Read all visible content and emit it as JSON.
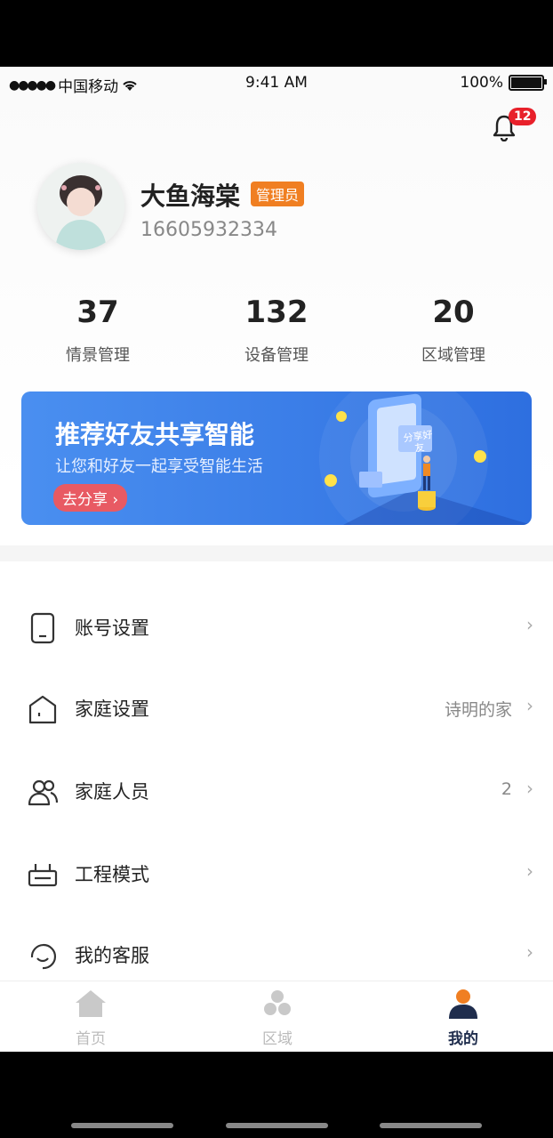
{
  "status_bar": {
    "carrier": "中国移动",
    "time": "9:41 AM",
    "battery": "100%"
  },
  "notifications": {
    "count": "12"
  },
  "profile": {
    "name": "大鱼海棠",
    "role": "管理员",
    "phone": "16605932334"
  },
  "stats": [
    {
      "value": "37",
      "label": "情景管理"
    },
    {
      "value": "132",
      "label": "设备管理"
    },
    {
      "value": "20",
      "label": "区域管理"
    }
  ],
  "banner": {
    "title": "推荐好友共享智能",
    "subtitle": "让您和好友一起享受智能生活",
    "button": "去分享",
    "art_text": "分享好友"
  },
  "menu": [
    {
      "label": "账号设置",
      "value": "",
      "icon": "phone-icon"
    },
    {
      "label": "家庭设置",
      "value": "诗明的家",
      "icon": "home-outline-icon"
    },
    {
      "label": "家庭人员",
      "value": "2",
      "icon": "people-icon"
    },
    {
      "label": "工程模式",
      "value": "",
      "icon": "router-icon"
    },
    {
      "label": "我的客服",
      "value": "",
      "icon": "support-icon"
    }
  ],
  "tabs": [
    {
      "label": "首页",
      "icon": "home-icon",
      "active": false
    },
    {
      "label": "区域",
      "icon": "area-icon",
      "active": false
    },
    {
      "label": "我的",
      "icon": "user-icon",
      "active": true
    }
  ],
  "colors": {
    "accent_orange": "#f07f22",
    "badge_red": "#e8202a",
    "banner_blue": "#3a7de8",
    "tab_active": "#1f2d4d"
  }
}
